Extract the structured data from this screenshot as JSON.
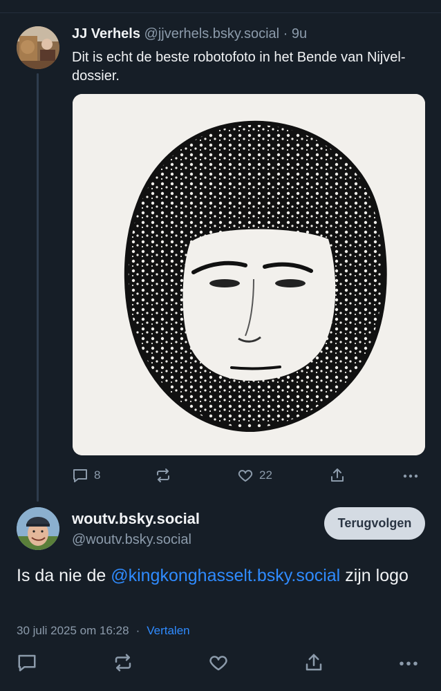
{
  "parent_post": {
    "display_name": "JJ Verhels",
    "handle": "@jjverhels.bsky.social",
    "time_separator": " · ",
    "time": "9u",
    "text": "Dit is echt de beste robotofoto in het Bende van Nijvel-dossier.",
    "image": {
      "icon": "robot-sketch-image"
    },
    "actions": {
      "reply_count": "8",
      "repost_count": "",
      "like_count": "22"
    }
  },
  "reply_post": {
    "display_name": "woutv.bsky.social",
    "handle": "@woutv.bsky.social",
    "follow_button": "Terugvolgen",
    "text_before": "Is da nie de ",
    "mention": "@kingkonghasselt.bsky.social",
    "text_after": " zijn logo",
    "timestamp": "30 juli 2025 om 16:28",
    "meta_separator": "·",
    "translate_label": "Vertalen"
  },
  "colors": {
    "background": "#161e27",
    "accent": "#2f8bff",
    "muted": "#8c9bab",
    "button_bg": "#d4dbe3"
  }
}
